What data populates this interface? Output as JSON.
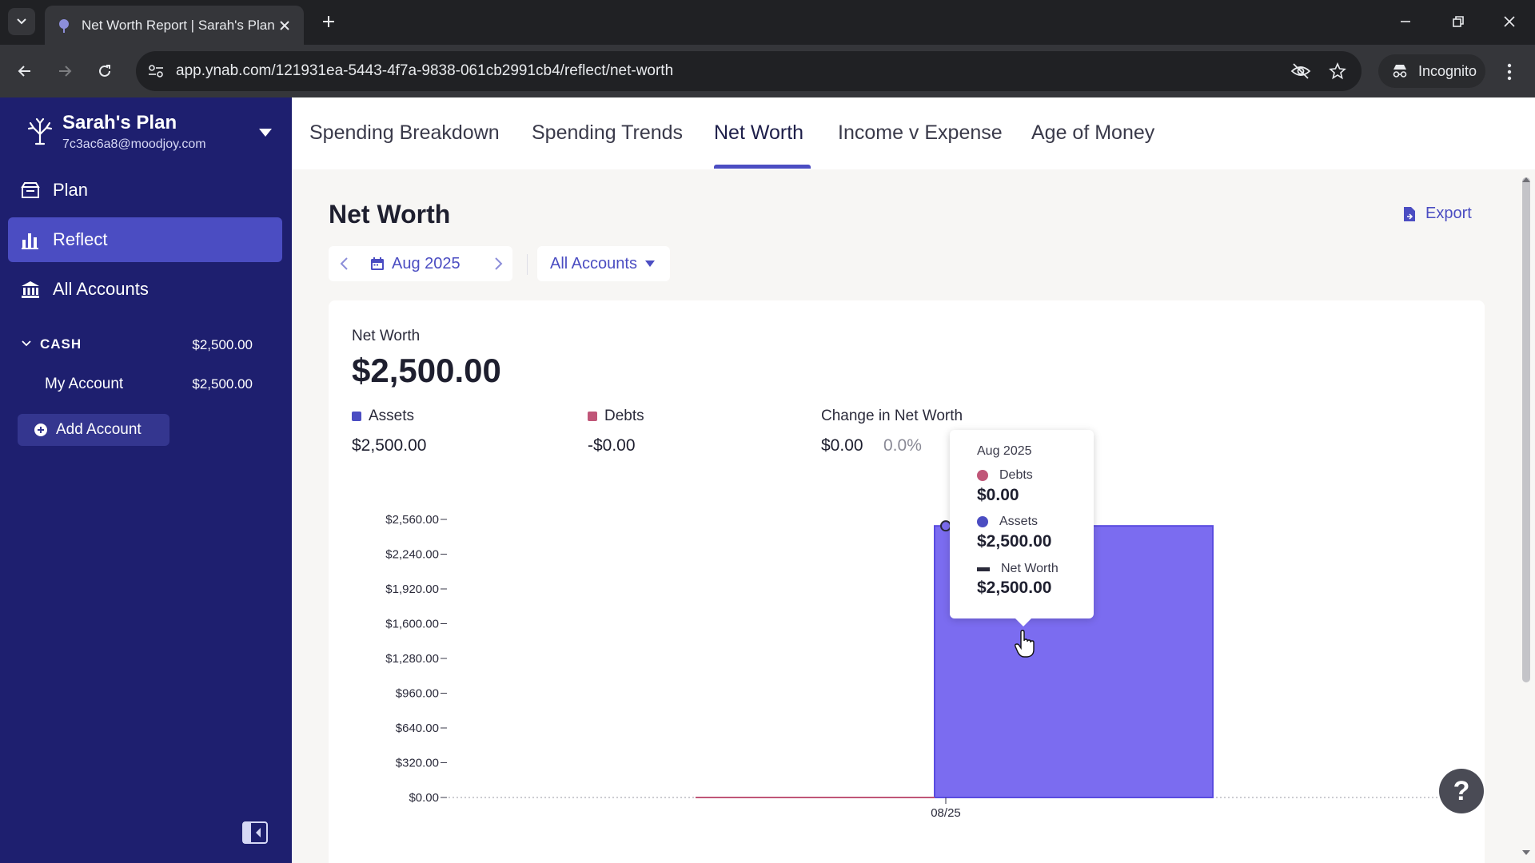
{
  "browser": {
    "tab_title": "Net Worth Report | Sarah's Plan",
    "url": "app.ynab.com/121931ea-5443-4f7a-9838-061cb2991cb4/reflect/net-worth",
    "incognito_label": "Incognito"
  },
  "sidebar": {
    "plan_name": "Sarah's Plan",
    "plan_email": "7c3ac6a8@moodjoy.com",
    "nav": [
      {
        "label": "Plan",
        "icon": "plan-icon"
      },
      {
        "label": "Reflect",
        "icon": "bar-chart-icon"
      },
      {
        "label": "All Accounts",
        "icon": "bank-icon"
      }
    ],
    "account_group": {
      "name": "CASH",
      "balance": "$2,500.00"
    },
    "accounts": [
      {
        "name": "My Account",
        "balance": "$2,500.00"
      }
    ],
    "add_account_label": "Add Account"
  },
  "report_tabs": [
    "Spending Breakdown",
    "Spending Trends",
    "Net Worth",
    "Income v Expense",
    "Age of Money"
  ],
  "report": {
    "title": "Net Worth",
    "export_label": "Export",
    "date_label": "Aug 2025",
    "accounts_filter": "All Accounts",
    "net_worth_label": "Net Worth",
    "net_worth_value": "$2,500.00",
    "assets_label": "Assets",
    "assets_value": "$2,500.00",
    "debts_label": "Debts",
    "debts_value": "-$0.00",
    "change_label": "Change in Net Worth",
    "change_value": "$0.00",
    "change_pct": "0.0%"
  },
  "tooltip": {
    "month": "Aug 2025",
    "debts_label": "Debts",
    "debts_value": "$0.00",
    "assets_label": "Assets",
    "assets_value": "$2,500.00",
    "net_worth_label": "Net Worth",
    "net_worth_value": "$2,500.00"
  },
  "colors": {
    "assets": "#7b6cf0",
    "assets_border": "#5a4ce0",
    "debts": "#c05678",
    "net_worth_line": "#2a2a3a",
    "accent": "#4b4dc2",
    "sidebar_bg": "#1e1f6f"
  },
  "chart_data": {
    "type": "bar",
    "categories": [
      "08/25"
    ],
    "series": [
      {
        "name": "Assets",
        "values": [
          2500
        ]
      },
      {
        "name": "Debts",
        "values": [
          0
        ]
      },
      {
        "name": "Net Worth",
        "values": [
          2500
        ]
      }
    ],
    "y_ticks": [
      "$0.00",
      "$320.00",
      "$640.00",
      "$960.00",
      "$1,280.00",
      "$1,600.00",
      "$1,920.00",
      "$2,240.00",
      "$2,560.00"
    ],
    "ylim": [
      0,
      2560
    ],
    "grid": false
  }
}
